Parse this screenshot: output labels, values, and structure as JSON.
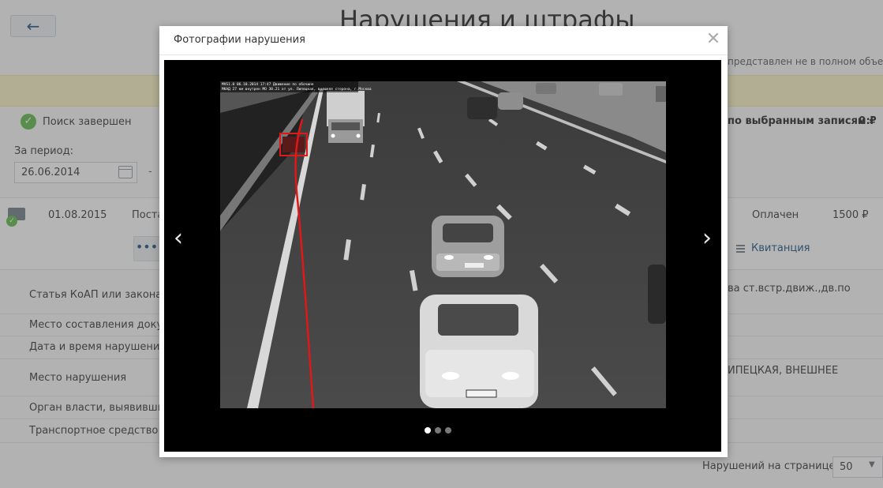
{
  "page": {
    "back_icon": "arrow-left-icon",
    "title": "Нарушения и штрафы",
    "warning_partial": "представлен не в полном объеме",
    "search_status": "Поиск завершен",
    "total_label": "по выбранным записям:",
    "total_value": "0 ₽",
    "period_label": "За период:",
    "date_from": "26.06.2014",
    "date_separator": "-"
  },
  "record": {
    "date": "01.08.2015",
    "description": "Поста",
    "status": "Оплачен",
    "amount": "1500 ₽",
    "more_label": "•••",
    "receipt_label": "Квитанция"
  },
  "details": [
    {
      "label": "Статья КоАП или закона су",
      "value": "ва ст.встр.движ.,дв.по"
    },
    {
      "label": "Место составления докуме",
      "value": ""
    },
    {
      "label": "Дата и время нарушения",
      "value": ""
    },
    {
      "label": "Место нарушения",
      "value": "ИПЕЦКАЯ, ВНЕШНЕЕ"
    },
    {
      "label": "Орган власти, выявивший",
      "value": ""
    },
    {
      "label": "Транспортное средство",
      "value": ""
    }
  ],
  "pagination": {
    "per_page_label": "Нарушений на странице:",
    "per_page_value": "50"
  },
  "modal": {
    "title": "Фотографии нарушения",
    "close_icon": "close-icon",
    "prev_icon": "chevron-left-icon",
    "next_icon": "chevron-right-icon",
    "slide_count": 3,
    "active_slide": 1,
    "photo_caption_line1": "MVS1.0 06.10.2014 17:47 Движение по обочине",
    "photo_caption_line2": "МКАД 27 км внутрен МО 30.21 от ул. Липецкая, внешняя сторона, г.Москва"
  },
  "colors": {
    "accent": "#2b5d8c",
    "success": "#6bbf59",
    "warning_band": "#fbf4c8",
    "violation_track": "#e01818"
  }
}
